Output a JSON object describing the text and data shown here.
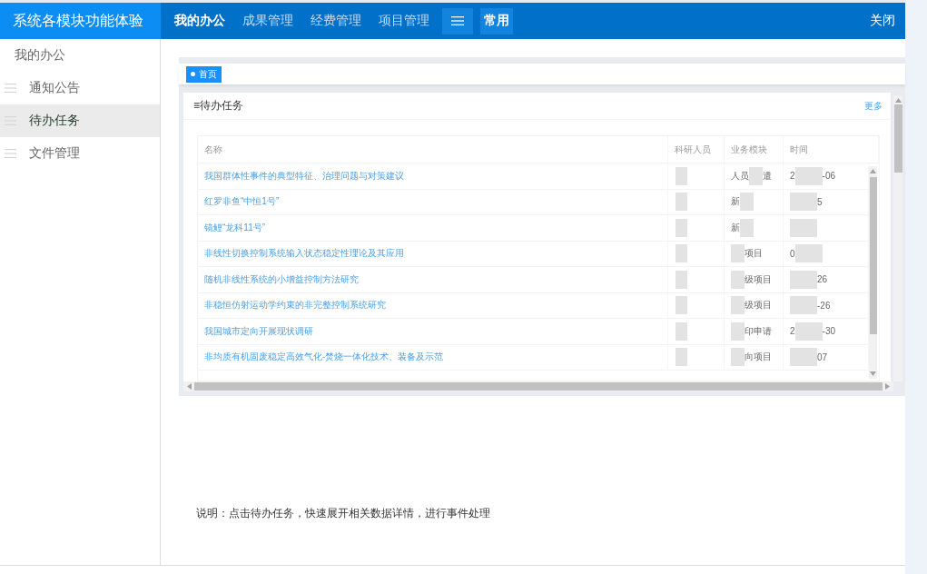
{
  "app_title": "系统各模块功能体验",
  "top_nav": {
    "items": [
      {
        "label": "我的办公",
        "selected": true
      },
      {
        "label": "成果管理",
        "selected": false
      },
      {
        "label": "经费管理",
        "selected": false
      },
      {
        "label": "项目管理",
        "selected": false
      }
    ],
    "shortcut": "常用",
    "close": "关闭"
  },
  "sidebar": {
    "items": [
      {
        "label": "我的办公",
        "kind": "group",
        "selected": false
      },
      {
        "label": "通知公告",
        "kind": "link",
        "selected": false
      },
      {
        "label": "待办任务",
        "kind": "link",
        "selected": true
      },
      {
        "label": "文件管理",
        "kind": "link",
        "selected": false
      }
    ]
  },
  "screenshot": {
    "tabs": [
      {
        "label": "首页",
        "selected": true
      }
    ],
    "panel": {
      "title": "≡待办任务",
      "more": "更多",
      "table": {
        "columns": [
          "名称",
          "科研人员",
          "业务模块",
          "时间"
        ],
        "rows": [
          {
            "name": "我国群体性事件的典型特征、治理问题与对策建议",
            "researcher": [
              {
                "kind": "mask"
              }
            ],
            "module": [
              {
                "kind": "text",
                "text": "人员"
              },
              {
                "kind": "mask"
              },
              {
                "kind": "text",
                "text": "遣"
              }
            ],
            "time": [
              {
                "kind": "text",
                "text": "2"
              },
              {
                "kind": "mask"
              },
              {
                "kind": "text",
                "text": "-06"
              }
            ]
          },
          {
            "name": "红罗非鱼“中恒1号”",
            "researcher": [
              {
                "kind": "mask"
              }
            ],
            "module": [
              {
                "kind": "text",
                "text": "新"
              },
              {
                "kind": "mask"
              }
            ],
            "time": [
              {
                "kind": "mask"
              },
              {
                "kind": "text",
                "text": "5"
              }
            ]
          },
          {
            "name": "镜鲤“龙科11号”",
            "researcher": [
              {
                "kind": "mask"
              }
            ],
            "module": [
              {
                "kind": "text",
                "text": "新"
              },
              {
                "kind": "mask"
              }
            ],
            "time": [
              {
                "kind": "mask"
              }
            ]
          },
          {
            "name": "非线性切换控制系统输入状态稳定性理论及其应用",
            "researcher": [
              {
                "kind": "mask"
              }
            ],
            "module": [
              {
                "kind": "mask"
              },
              {
                "kind": "text",
                "text": "项目"
              }
            ],
            "time": [
              {
                "kind": "text",
                "text": "0"
              },
              {
                "kind": "mask"
              }
            ]
          },
          {
            "name": "随机非线性系统的小增益控制方法研究",
            "researcher": [
              {
                "kind": "mask"
              }
            ],
            "module": [
              {
                "kind": "mask"
              },
              {
                "kind": "text",
                "text": "级项目"
              }
            ],
            "time": [
              {
                "kind": "mask"
              },
              {
                "kind": "text",
                "text": "26"
              }
            ]
          },
          {
            "name": "非稳恒仿射运动学约束的非完整控制系统研究",
            "researcher": [
              {
                "kind": "mask"
              }
            ],
            "module": [
              {
                "kind": "mask"
              },
              {
                "kind": "text",
                "text": "级项目"
              }
            ],
            "time": [
              {
                "kind": "mask"
              },
              {
                "kind": "text",
                "text": "-26"
              }
            ]
          },
          {
            "name": "我国城市定向开展现状调研",
            "researcher": [
              {
                "kind": "mask"
              }
            ],
            "module": [
              {
                "kind": "mask"
              },
              {
                "kind": "text",
                "text": "印申请"
              }
            ],
            "time": [
              {
                "kind": "text",
                "text": "2"
              },
              {
                "kind": "mask"
              },
              {
                "kind": "text",
                "text": "-30"
              }
            ]
          },
          {
            "name": "非均质有机固废稳定高效气化-焚烧一体化技术、装备及示范",
            "researcher": [
              {
                "kind": "mask"
              }
            ],
            "module": [
              {
                "kind": "mask"
              },
              {
                "kind": "text",
                "text": "向项目"
              }
            ],
            "time": [
              {
                "kind": "mask"
              },
              {
                "kind": "text",
                "text": "07"
              }
            ]
          }
        ]
      }
    }
  },
  "note": "说明：点击待办任务，快速展开相关数据详情，进行事件处理"
}
